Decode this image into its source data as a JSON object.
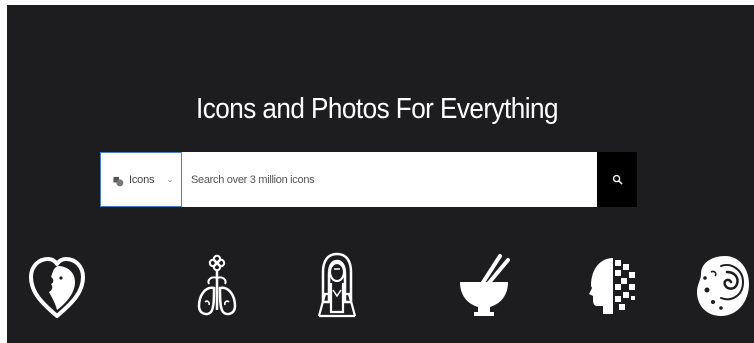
{
  "hero": {
    "title": "Icons and Photos For Everything",
    "background_color": "#1d1d1f"
  },
  "search": {
    "type_selector": {
      "selected": "Icons",
      "icon": "shapes-icon",
      "chevron": "chevron-down-icon"
    },
    "input": {
      "placeholder": "Search over 3 million icons",
      "value": ""
    },
    "button_icon": "search-icon",
    "button_color": "#000000",
    "selector_border_color": "#4a7fc0"
  },
  "showcase_icons": [
    "heart-face-icon",
    "lungs-flower-icon",
    "woman-figure-icon",
    "bowl-chopsticks-icon",
    "pixelated-head-icon",
    "organic-cell-icon"
  ]
}
